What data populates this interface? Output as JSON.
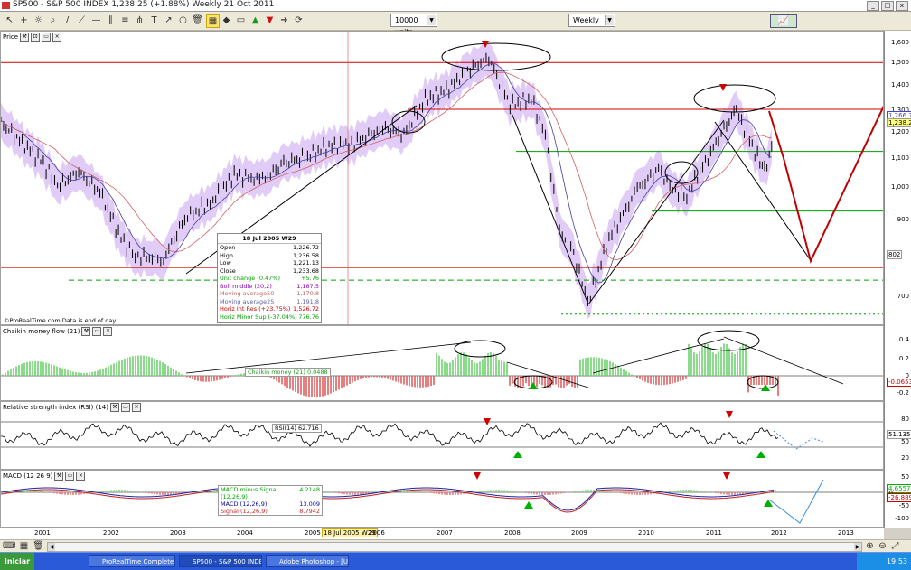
{
  "window": {
    "title": "SP500 - S&P 500 INDEX    1,238.25 (+1.88%)    Weekly  21 Oct 2011"
  },
  "toolbar": {
    "units_select": "10000 units",
    "period_select": "Weekly"
  },
  "price_panel": {
    "title": "Price",
    "source_note": "©ProRealTime.com  Data is end of day",
    "y_ticks": [
      "1,600",
      "1,500",
      "1,400",
      "1,300",
      "1,200",
      "1,100",
      "1,000",
      "900",
      "700"
    ],
    "tags": [
      {
        "text": "1,266.7",
        "color": "#4444cc"
      },
      {
        "text": "1,238.25",
        "color": "#000000"
      },
      {
        "text": "802",
        "color": "#000000"
      }
    ]
  },
  "infobox": {
    "date": "18 Jul 2005 W29",
    "rows": [
      {
        "k": "Open",
        "v": "1,226.72",
        "c": "#000000"
      },
      {
        "k": "High",
        "v": "1,236.58",
        "c": "#000000"
      },
      {
        "k": "Low",
        "v": "1,221.13",
        "c": "#000000"
      },
      {
        "k": "Close",
        "v": "1,233.68",
        "c": "#000000"
      },
      {
        "k": "Unit change (0.47%)",
        "v": "+5.76",
        "c": "#00a000"
      },
      {
        "k": "Boll middle (20,2)",
        "v": "1,187.5",
        "c": "#8a00c0"
      },
      {
        "k": "Moving average50",
        "v": "1,170.8",
        "c": "#c06060"
      },
      {
        "k": "Moving average25",
        "v": "1,191.8",
        "c": "#6060a0"
      },
      {
        "k": "Horiz Int Res (+23.75%)",
        "v": "1,526.72",
        "c": "#cc0000"
      },
      {
        "k": "Horiz Minor Sup (-37.04%)",
        "v": "776.76",
        "c": "#00a000"
      }
    ]
  },
  "cmf_panel": {
    "title": "Chaikin money flow (21)",
    "label": "Chaikin money (21)  0.0488",
    "y_ticks": [
      "0.4",
      "0.2",
      "0",
      "-0.2"
    ],
    "tag": "-0.0653"
  },
  "rsi_panel": {
    "title": "Relative strength index (RSI) (14)",
    "label": "RSI(14)  62.716",
    "y_ticks": [
      "80",
      "51.135",
      "50",
      "20"
    ]
  },
  "macd_panel": {
    "title": "MACD (12 26 9)",
    "rows": [
      {
        "k": "MACD minus Signal (12,26,9)",
        "v": "4.2148",
        "c": "#00aa00"
      },
      {
        "k": "MACD (12,26,9)",
        "v": "13.009",
        "c": "#0000aa"
      },
      {
        "k": "Signal (12,26,9)",
        "v": "8.7942",
        "c": "#cc2222"
      }
    ],
    "y_ticks": [
      "50",
      "0",
      "-50",
      "-100"
    ],
    "tags": [
      "4.6557",
      "-26.889"
    ]
  },
  "xaxis": {
    "years": [
      "2001",
      "2002",
      "2003",
      "2004",
      "2005",
      "2006",
      "2007",
      "2008",
      "2009",
      "2010",
      "2011",
      "2012",
      "2013"
    ],
    "highlight": "18 Jul 2005 W29"
  },
  "taskbar": {
    "start": "Iniciar",
    "tasks": [
      "ProRealTime Complete",
      "SP500 - S&P 500 INDEX ...",
      "Adobe Photoshop - [Unti..."
    ],
    "clock": "19:53"
  },
  "chart_data": {
    "type": "line",
    "title": "SP500 - S&P 500 INDEX Weekly",
    "x": [
      2000.9,
      2001.2,
      2001.5,
      2001.7,
      2002.0,
      2002.3,
      2002.6,
      2002.8,
      2003.2,
      2003.5,
      2003.9,
      2004.2,
      2004.6,
      2004.9,
      2005.2,
      2005.5,
      2005.9,
      2006.3,
      2006.6,
      2006.9,
      2007.2,
      2007.5,
      2007.8,
      2008.1,
      2008.4,
      2008.6,
      2008.8,
      2009.0,
      2009.2,
      2009.5,
      2009.9,
      2010.2,
      2010.4,
      2010.6,
      2010.9,
      2011.2,
      2011.3,
      2011.6,
      2011.7,
      2011.8
    ],
    "series": [
      {
        "values": [
          1320,
          1250,
          1180,
          1100,
          1150,
          1080,
          920,
          860,
          850,
          990,
          1050,
          1140,
          1120,
          1180,
          1200,
          1235,
          1250,
          1300,
          1280,
          1400,
          1430,
          1500,
          1540,
          1380,
          1400,
          1280,
          950,
          870,
          700,
          920,
          1090,
          1160,
          1090,
          1070,
          1200,
          1330,
          1360,
          1200,
          1150,
          1238
        ]
      }
    ],
    "ylim": [
      650,
      1620
    ]
  }
}
